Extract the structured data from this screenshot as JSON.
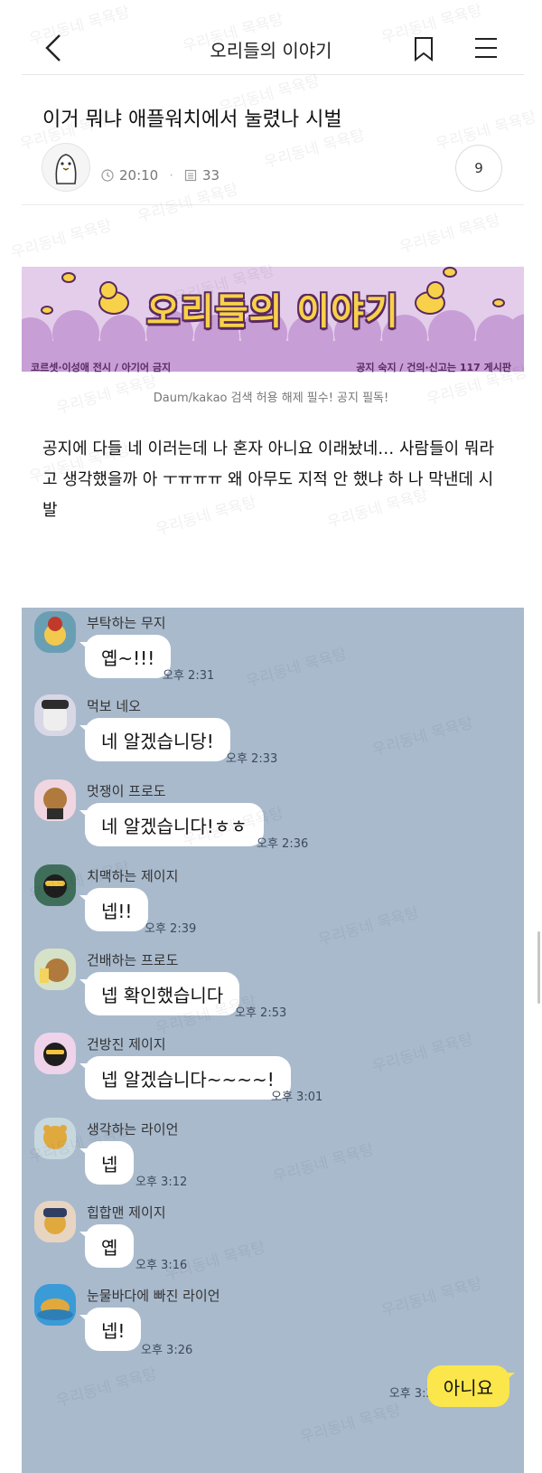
{
  "header": {
    "title": "오리들의 이야기"
  },
  "post": {
    "title": "이거 뭐냐 애플워치에서 눌렸나 시벌",
    "time": "20:10",
    "views": "33",
    "comment_count": "9",
    "body": "공지에 다들 네 이러는데 나 혼자 아니요 이래놨네… 사람들이 뭐라고 생각했을까 아 ㅜㅠㅠㅠ 왜 아무도 지적 안 했냐 하 나 막낸데 시발"
  },
  "banner": {
    "title": "오리들의 이야기",
    "left_note": "코르셋·이성애 전시 / 아기어 금지",
    "right_note": "공지 숙지 / 건의·신고는 117 게시판",
    "caption": "Daum/kakao 검색 허용 해제 필수! 공지 필독!"
  },
  "watermark_text": "우리동네 목욕탕",
  "chat": {
    "messages": [
      {
        "name": "부탁하는 무지",
        "text": "옙~!!!",
        "time": "오후 2:31"
      },
      {
        "name": "먹보 네오",
        "text": "네 알겠습니당!",
        "time": "오후 2:33"
      },
      {
        "name": "멋쟁이 프로도",
        "text": "네 알겠습니다!ㅎㅎ",
        "time": "오후 2:36"
      },
      {
        "name": "치맥하는 제이지",
        "text": "넵!!",
        "time": "오후 2:39"
      },
      {
        "name": "건배하는 프로도",
        "text": "넵 확인했습니다",
        "time": "오후 2:53"
      },
      {
        "name": "건방진 제이지",
        "text": "넵 알겠습니다~~~~!",
        "time": "오후 3:01"
      },
      {
        "name": "생각하는 라이언",
        "text": "넵",
        "time": "오후 3:12"
      },
      {
        "name": "힙합맨 제이지",
        "text": "옙",
        "time": "오후 3:16"
      },
      {
        "name": "눈물바다에 빠진 라이언",
        "text": "넵!",
        "time": "오후 3:26"
      }
    ],
    "mine": {
      "text": "아니요",
      "time": "오후 3:28"
    }
  },
  "colors": {
    "chat_bg": "#a9bacd",
    "my_bubble": "#fbe64b",
    "banner_bg": "#e3cdea",
    "banner_text": "#f7d14a"
  }
}
